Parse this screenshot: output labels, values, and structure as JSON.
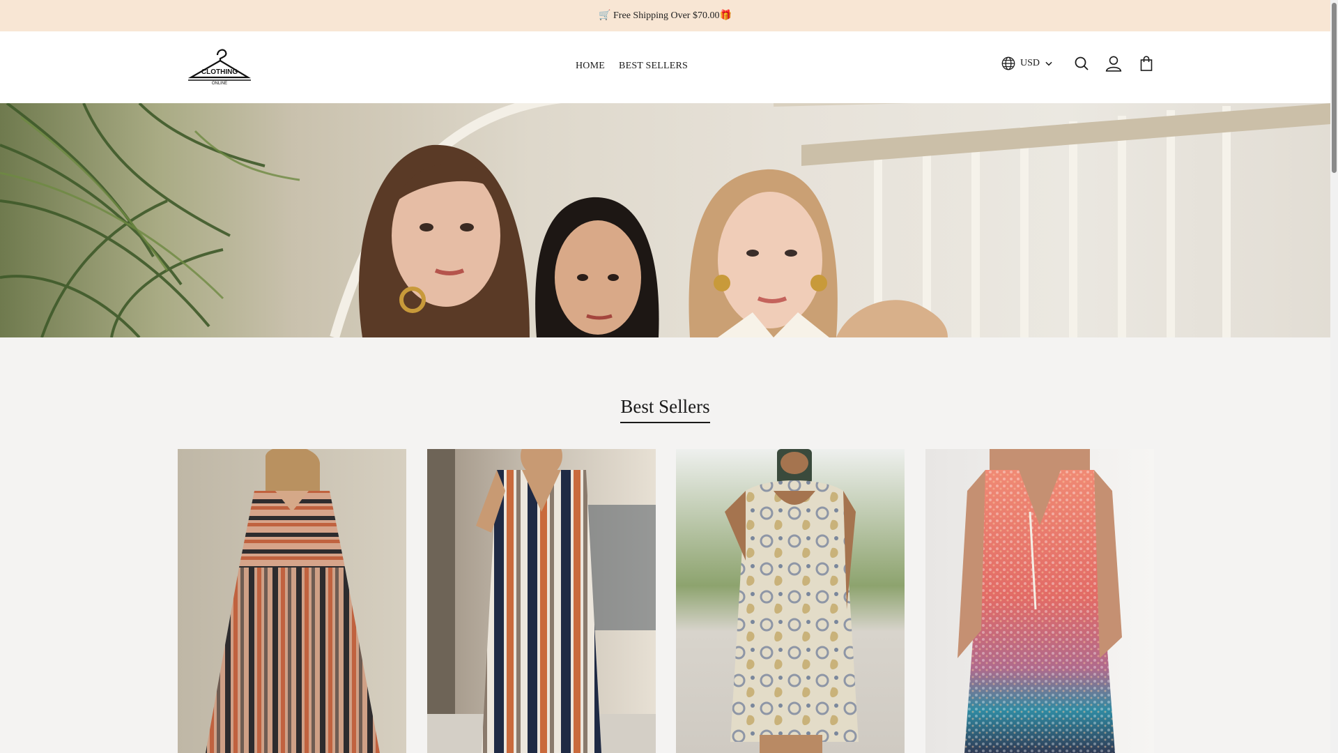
{
  "announcement": {
    "text": "🛒 Free Shipping Over $70.00🎁"
  },
  "brand": {
    "logo_text": "CLOTHING",
    "logo_subtext": "ONLINE"
  },
  "nav": {
    "items": [
      {
        "label": "HOME"
      },
      {
        "label": "BEST SELLERS"
      }
    ]
  },
  "header_tools": {
    "currency": "USD",
    "icons": [
      "globe-icon",
      "chevron-down-icon",
      "search-icon",
      "user-icon",
      "shopping-bag-icon"
    ]
  },
  "hero": {
    "description_icon": "hero-banner-image"
  },
  "best_sellers": {
    "title": "Best Sellers",
    "products": [
      {
        "image": "striped-maxi-dress-image"
      },
      {
        "image": "vertical-stripe-midi-dress-image"
      },
      {
        "image": "paisley-print-dress-image"
      },
      {
        "image": "sequin-gradient-sleeveless-dress-image"
      }
    ]
  },
  "colors": {
    "announcement_bg": "#f8e6d4",
    "page_bg": "#f4f3f2",
    "text": "#1a1a1a"
  }
}
